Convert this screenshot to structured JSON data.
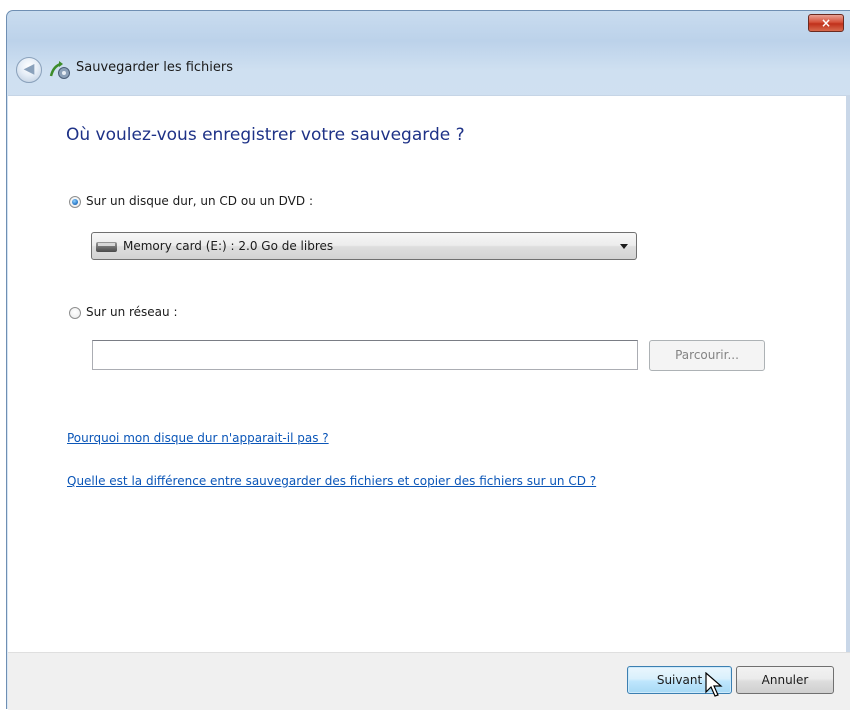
{
  "window": {
    "title": "Sauvegarder les fichiers",
    "close_label": "×"
  },
  "main": {
    "heading": "Où voulez-vous enregistrer votre sauvegarde ?",
    "option_disk": {
      "label": "Sur un disque dur, un CD ou un DVD :",
      "checked": true
    },
    "drive_select": {
      "selected": "Memory card (E:) : 2.0 Go de libres"
    },
    "option_network": {
      "label": "Sur un réseau :",
      "checked": false
    },
    "network_path": {
      "value": "",
      "placeholder": ""
    },
    "browse_label": "Parcourir...",
    "link_why": "Pourquoi mon disque dur n'apparait-il pas ?",
    "link_difference": "Quelle est la différence entre sauvegarder des fichiers et copier des fichiers sur un CD ?"
  },
  "footer": {
    "next_label": "Suivant",
    "cancel_label": "Annuler"
  },
  "colors": {
    "heading": "#1e3287",
    "link": "#0b56b8",
    "title_bar": "#c9dcef"
  },
  "icons": {
    "back": "back-arrow-icon",
    "app": "backup-files-icon",
    "drive": "memory-card-drive-icon",
    "close": "close-icon"
  }
}
